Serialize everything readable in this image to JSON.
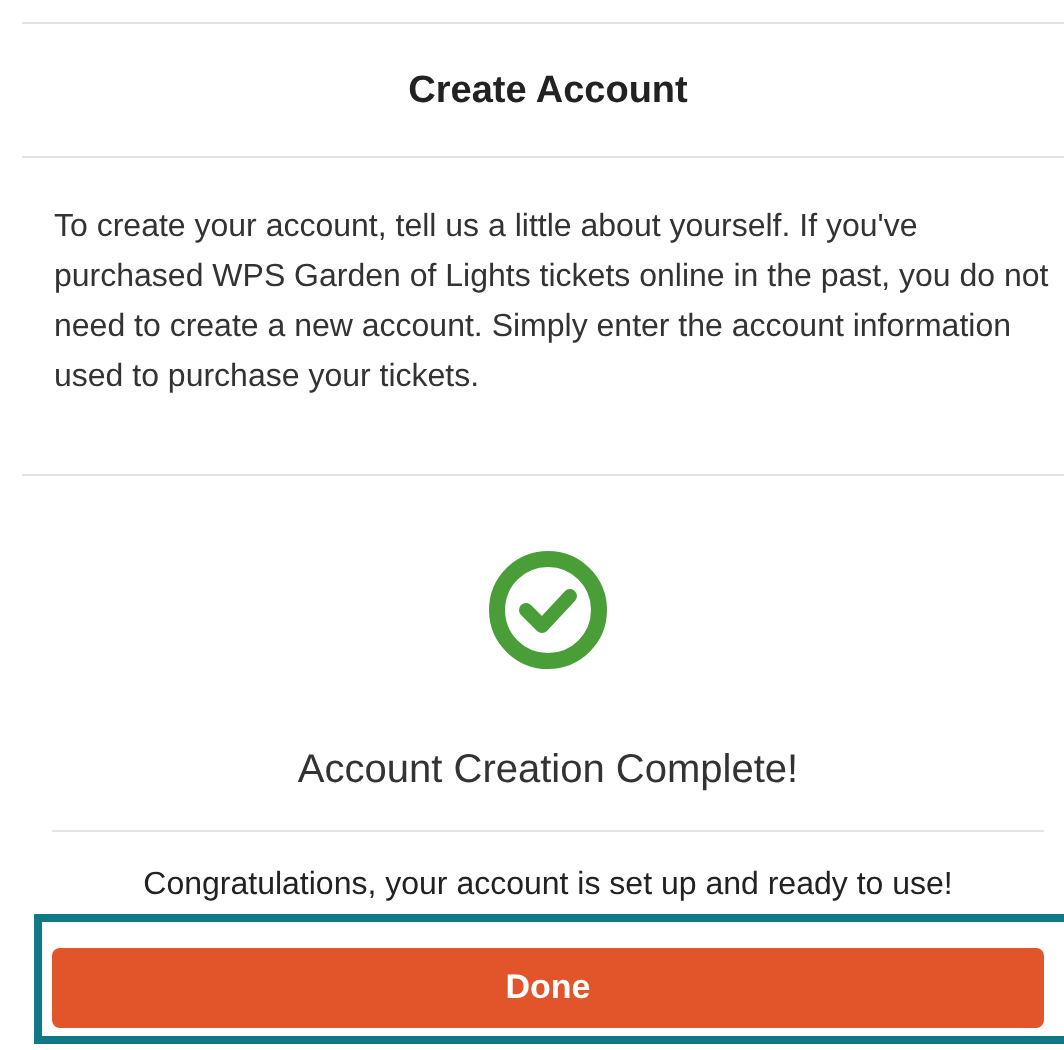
{
  "title": "Create Account",
  "intro": "To create your account, tell us a little about yourself. If you've purchased WPS Garden of Lights tickets online in the past, you do not need to create a new account. Simply enter the account information used to purchase your tickets.",
  "status": {
    "heading": "Account Creation Complete!",
    "message": "Congratulations, your account is set up and ready to use!"
  },
  "done_button": {
    "label": "Done",
    "focused": true
  }
}
